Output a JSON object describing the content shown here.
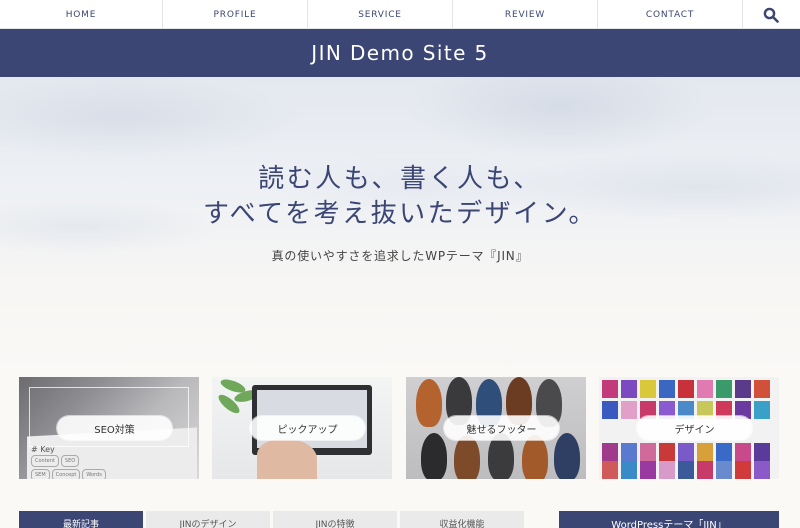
{
  "nav": {
    "items": [
      "HOME",
      "PROFILE",
      "SERVICE",
      "REVIEW",
      "CONTACT"
    ],
    "search_icon": "search-icon"
  },
  "header": {
    "title": "JIN Demo Site 5"
  },
  "hero": {
    "headline_line1": "読む人も、書く人も、",
    "headline_line2": "すべてを考え抜いたデザイン。",
    "subtitle": "真の使いやすさを追求したWPテーマ『JIN』"
  },
  "cards": [
    {
      "label": "SEO対策",
      "image": "keyword-tags-photo"
    },
    {
      "label": "ピックアップ",
      "image": "laptop-desk-photo"
    },
    {
      "label": "魅せるフッター",
      "image": "shoes-photo"
    },
    {
      "label": "デザイン",
      "image": "neckties-photo"
    }
  ],
  "card1_tags": [
    "Content",
    "SEO",
    "SEM",
    "Concept",
    "Words"
  ],
  "card1_heading": "# Key",
  "tabs": [
    "最新記事",
    "JINのデザイン",
    "JINの特徴",
    "収益化機能"
  ],
  "sidebar": {
    "heading": "WordPressテーマ「JIN」"
  },
  "colors": {
    "brand": "#3b4675",
    "nav_bg": "#ffffff",
    "tab_bg": "#ebeaea"
  }
}
